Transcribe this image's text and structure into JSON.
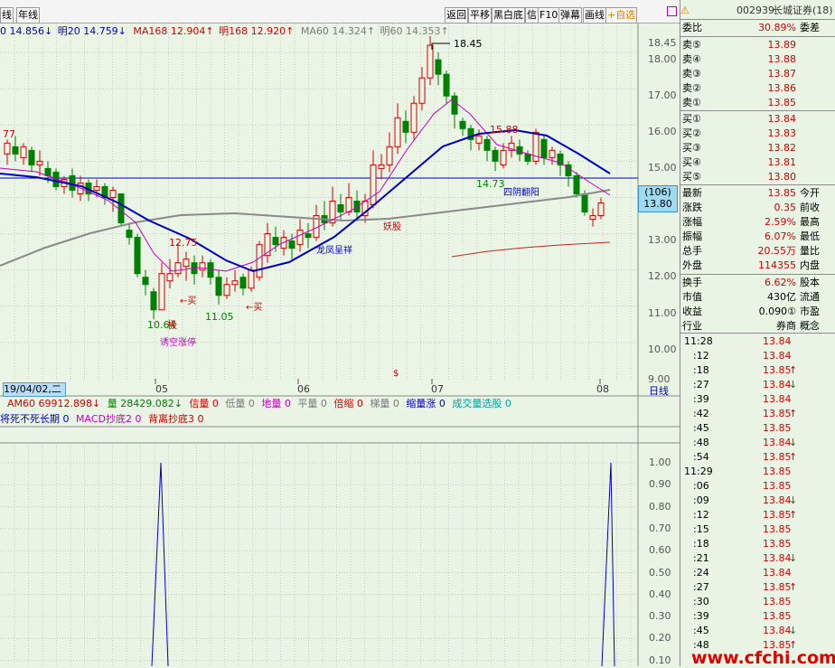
{
  "toolbar": {
    "left_tabs": [
      "线",
      "年线"
    ],
    "buttons": [
      "返回",
      "平移",
      "黑白底",
      "信",
      "F10",
      "弹幕",
      "画线"
    ],
    "favorite": "+自选"
  },
  "ma_legend": [
    {
      "text": "0 14.856↓",
      "color": "#0000c0"
    },
    {
      "text": "明20 14.759↓",
      "color": "#0000c0"
    },
    {
      "text": "MA168 12.904↑",
      "color": "#d40000"
    },
    {
      "text": "明168 12.920↑",
      "color": "#d40000"
    },
    {
      "text": "MA60 14.324↑",
      "color": "#7a7a7a"
    },
    {
      "text": "明60 14.353↑",
      "color": "#7a7a7a"
    }
  ],
  "price_axis": [
    "18.45",
    "18.00",
    "17.00",
    "16.00",
    "15.00",
    "14.00",
    "13.00",
    "12.00",
    "11.00",
    "10.00",
    "9.00"
  ],
  "annotations": {
    "high_label": "18.45",
    "left_77": "77",
    "p1588": "15.88",
    "p1473": "14.73",
    "p1275": "12.75",
    "p1105": "11.05",
    "p1064": "10.64",
    "sxfy": "四阴翻阳",
    "lfcx": "龙凤呈祥",
    "yaogu": "妖股",
    "ykzt": "诱空涨停",
    "buy1": "←买",
    "buy2": "←买",
    "ji": "极",
    "dollar": "$",
    "price_tag_top": "(106)",
    "price_tag_bottom": "13.80"
  },
  "time_axis": {
    "date_box": "19/04/02,二",
    "labels": [
      "05",
      "06",
      "07",
      "08"
    ],
    "period": "日线"
  },
  "volume_legend": [
    {
      "text": "AM60 69912.898↓",
      "color": "#d40000"
    },
    {
      "text": "量 28429.082↓",
      "color": "#008000"
    },
    {
      "text": "信量 0",
      "color": "#d40000"
    },
    {
      "text": "低量 0",
      "color": "#7a7a7a"
    },
    {
      "text": "地量 0",
      "color": "#c000c0"
    },
    {
      "text": "平量 0",
      "color": "#7a7a7a"
    },
    {
      "text": "倍缩 0",
      "color": "#d40000"
    },
    {
      "text": "梯量 0",
      "color": "#7a7a7a"
    },
    {
      "text": "缩量涨 0",
      "color": "#0000c0"
    },
    {
      "text": "成交量选股 0",
      "color": "#00a0a0"
    }
  ],
  "indicator_legend": [
    {
      "text": "将死不死长期 0",
      "color": "#0000c0"
    },
    {
      "text": "MACD抄底2 0",
      "color": "#c000c0"
    },
    {
      "text": "背离抄底3 0",
      "color": "#d40000"
    }
  ],
  "indicator_axis": [
    "1.00",
    "0.90",
    "0.80",
    "0.70",
    "0.60",
    "0.50",
    "0.40",
    "0.30",
    "0.20",
    "0.10"
  ],
  "stock": {
    "code": "002939",
    "name": "长城证券(18)"
  },
  "quote": {
    "weibi_label": "委比",
    "weibi": "30.89%",
    "weicha_label": "委差",
    "asks": [
      {
        "label": "卖⑤",
        "price": "13.89"
      },
      {
        "label": "卖④",
        "price": "13.88"
      },
      {
        "label": "卖③",
        "price": "13.87"
      },
      {
        "label": "卖②",
        "price": "13.86"
      },
      {
        "label": "卖①",
        "price": "13.85"
      }
    ],
    "bids": [
      {
        "label": "买①",
        "price": "13.84"
      },
      {
        "label": "买②",
        "price": "13.83"
      },
      {
        "label": "买③",
        "price": "13.82"
      },
      {
        "label": "买④",
        "price": "13.81"
      },
      {
        "label": "买⑤",
        "price": "13.80"
      }
    ],
    "stats": [
      {
        "l": "最新",
        "v": "13.85",
        "r": "今开",
        "cls": "red"
      },
      {
        "l": "涨跌",
        "v": "0.35",
        "r": "前收",
        "cls": "red"
      },
      {
        "l": "涨幅",
        "v": "2.59%",
        "r": "最高",
        "cls": "red"
      },
      {
        "l": "振幅",
        "v": "6.07%",
        "r": "最低",
        "cls": "red"
      },
      {
        "l": "总手",
        "v": "20.55万",
        "r": "量比",
        "cls": "red"
      },
      {
        "l": "外盘",
        "v": "114355",
        "r": "内盘",
        "cls": "red"
      }
    ],
    "stats2": [
      {
        "l": "换手",
        "v": "6.62%",
        "r": "股本",
        "cls": "red"
      },
      {
        "l": "市值",
        "v": "430亿",
        "r": "流通",
        "cls": "blk"
      },
      {
        "l": "收益",
        "v": "0.090①",
        "r": "市盈",
        "cls": "blk"
      },
      {
        "l": "行业",
        "v": "券商",
        "r": "概念",
        "cls": "blk"
      }
    ]
  },
  "ticks": [
    {
      "t": "11:28",
      "p": "13.84",
      "a": ""
    },
    {
      "t": ":12",
      "p": "13.84",
      "a": ""
    },
    {
      "t": ":18",
      "p": "13.85",
      "a": "↑"
    },
    {
      "t": ":27",
      "p": "13.84",
      "a": "↓"
    },
    {
      "t": ":39",
      "p": "13.84",
      "a": ""
    },
    {
      "t": ":42",
      "p": "13.85",
      "a": "↑"
    },
    {
      "t": ":45",
      "p": "13.85",
      "a": ""
    },
    {
      "t": ":48",
      "p": "13.84",
      "a": "↓"
    },
    {
      "t": ":54",
      "p": "13.85",
      "a": "↑"
    },
    {
      "t": "11:29",
      "p": "13.85",
      "a": ""
    },
    {
      "t": ":06",
      "p": "13.85",
      "a": ""
    },
    {
      "t": ":09",
      "p": "13.84",
      "a": "↓"
    },
    {
      "t": ":12",
      "p": "13.85",
      "a": "↑"
    },
    {
      "t": ":15",
      "p": "13.85",
      "a": ""
    },
    {
      "t": ":18",
      "p": "13.85",
      "a": ""
    },
    {
      "t": ":21",
      "p": "13.84",
      "a": "↓"
    },
    {
      "t": ":24",
      "p": "13.84",
      "a": ""
    },
    {
      "t": ":27",
      "p": "13.85",
      "a": "↑"
    },
    {
      "t": ":30",
      "p": "13.85",
      "a": ""
    },
    {
      "t": ":39",
      "p": "13.85",
      "a": ""
    },
    {
      "t": ":45",
      "p": "13.84",
      "a": "↓"
    },
    {
      "t": ":48",
      "p": "13.85",
      "a": "↑"
    }
  ],
  "watermark": "www.cfchi.com"
}
